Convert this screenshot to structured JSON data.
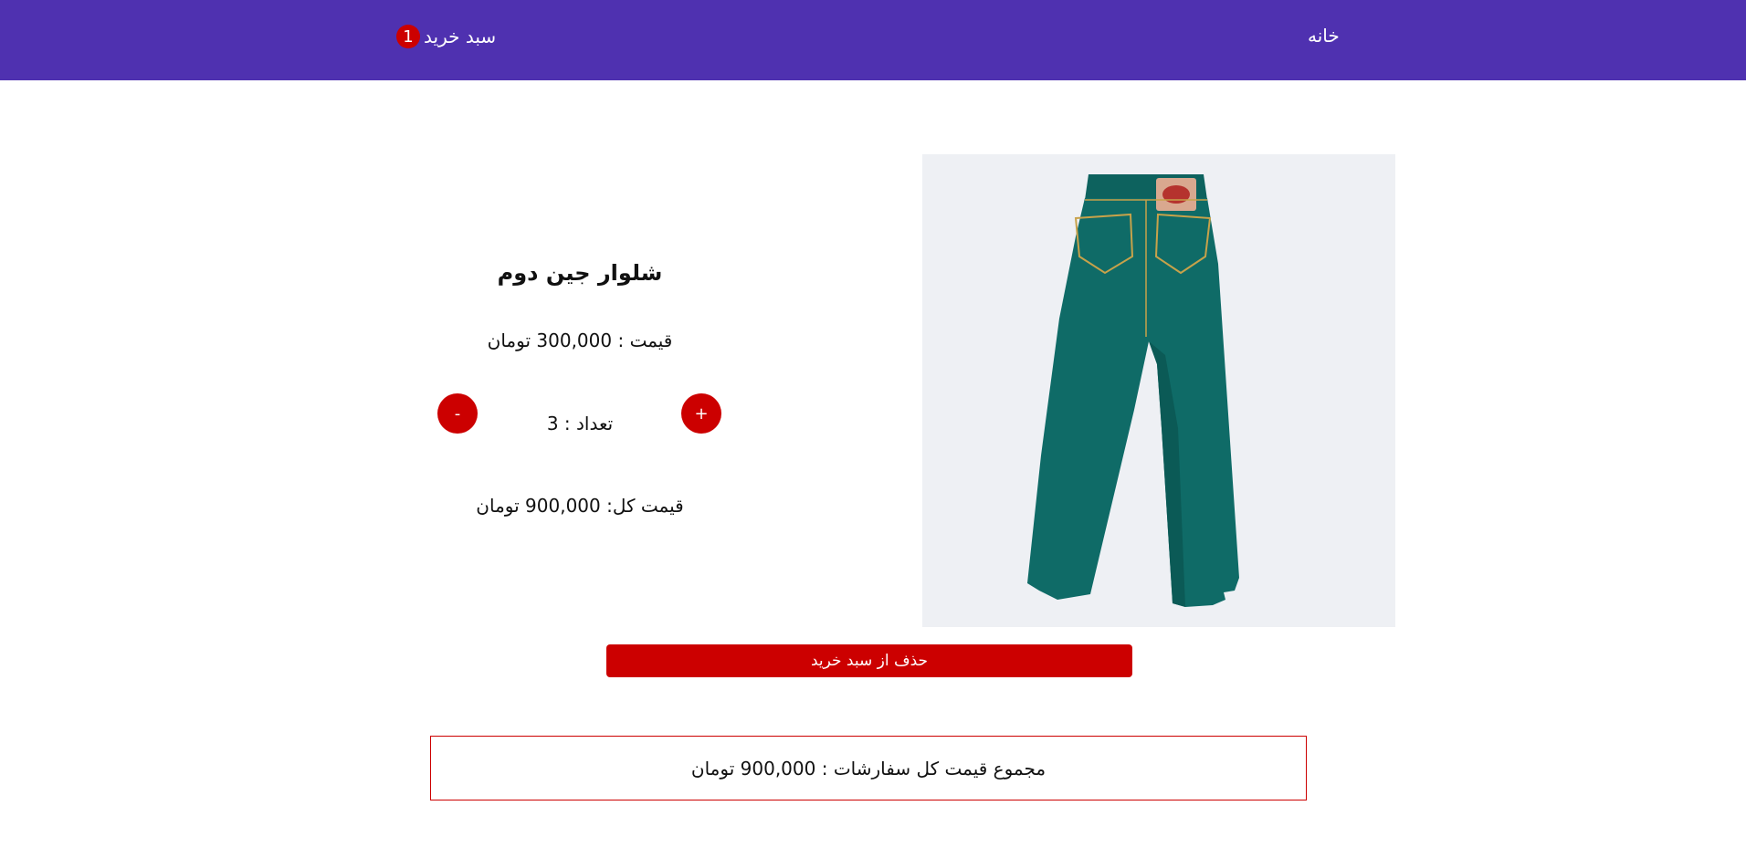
{
  "nav": {
    "home_label": "خانه",
    "cart_label": "سبد خرید",
    "cart_count": "1"
  },
  "product": {
    "title": "شلوار جین دوم",
    "price_text": "قیمت : 300,000 تومان",
    "quantity_text": "تعداد : 3",
    "total_text": "قیمت کل: 900,000 تومان",
    "plus_label": "+",
    "minus_label": "-",
    "image_icon": "jeans-image",
    "remove_label": "حذف از سبد خرید"
  },
  "summary": {
    "text": "مجموع قیمت کل سفارشات : 900,000 تومان"
  },
  "colors": {
    "navbar": "#4f31b0",
    "accent": "#cc0000",
    "jeans": "#0f6b67"
  }
}
